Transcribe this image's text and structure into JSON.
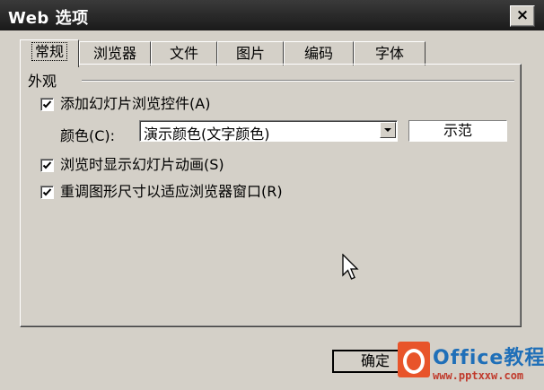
{
  "window": {
    "title": "Web 选项",
    "close_glyph": "×"
  },
  "tabs": [
    {
      "label": "常规"
    },
    {
      "label": "浏览器"
    },
    {
      "label": "文件"
    },
    {
      "label": "图片"
    },
    {
      "label": "编码"
    },
    {
      "label": "字体"
    }
  ],
  "group": {
    "label": "外观"
  },
  "options": [
    {
      "label": "添加幻灯片浏览控件(A)",
      "checked": true
    },
    {
      "label": "浏览时显示幻灯片动画(S)",
      "checked": true
    },
    {
      "label": "重调图形尺寸以适应浏览器窗口(R)",
      "checked": true
    }
  ],
  "color": {
    "label": "颜色(C):",
    "selected": "演示颜色(文字颜色)",
    "preview": "示范"
  },
  "buttons": {
    "ok": "确定"
  },
  "watermark": {
    "brand": "Office教程网",
    "url": "www.pptxxw.com"
  }
}
